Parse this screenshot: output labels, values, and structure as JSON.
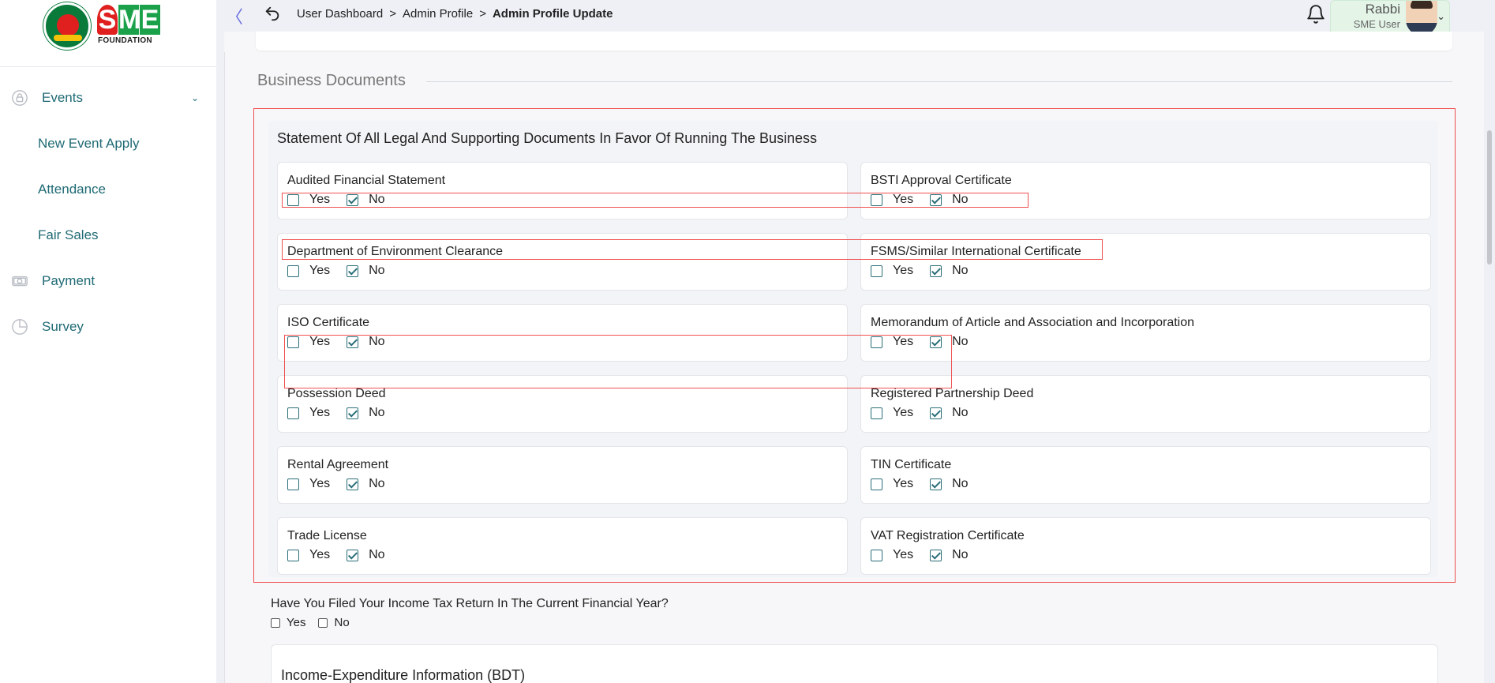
{
  "sidebar": {
    "logo_text": "SME",
    "logo_subtext": "FOUNDATION",
    "items": [
      {
        "label": "Events",
        "icon": "lock-icon",
        "expandable": true
      },
      {
        "label": "New Event Apply"
      },
      {
        "label": "Attendance"
      },
      {
        "label": "Fair Sales"
      },
      {
        "label": "Payment",
        "icon": "money-icon"
      },
      {
        "label": "Survey",
        "icon": "pie-chart-icon"
      }
    ]
  },
  "header": {
    "collapse_glyph": "〈",
    "breadcrumb": [
      "User Dashboard",
      "Admin Profile",
      "Admin Profile Update"
    ],
    "separator": ">",
    "user": {
      "name": "Rabbi",
      "role": "SME User"
    },
    "caret": "⌄"
  },
  "section": {
    "title": "Business Documents",
    "heading": "Statement Of All Legal And Supporting Documents In Favor Of Running The Business",
    "yes_label": "Yes",
    "no_label": "No",
    "documents": [
      {
        "label": "Audited Financial Statement",
        "yes": false,
        "no": true
      },
      {
        "label": "BSTI Approval Certificate",
        "yes": false,
        "no": true
      },
      {
        "label": "Department of Environment Clearance",
        "yes": false,
        "no": true
      },
      {
        "label": "FSMS/Similar International Certificate",
        "yes": false,
        "no": true
      },
      {
        "label": "ISO Certificate",
        "yes": false,
        "no": true
      },
      {
        "label": "Memorandum of Article and Association and Incorporation",
        "yes": false,
        "no": true
      },
      {
        "label": "Possession Deed",
        "yes": false,
        "no": true
      },
      {
        "label": "Registered Partnership Deed",
        "yes": false,
        "no": true
      },
      {
        "label": "Rental Agreement",
        "yes": false,
        "no": true
      },
      {
        "label": "TIN Certificate",
        "yes": false,
        "no": true
      },
      {
        "label": "Trade License",
        "yes": false,
        "no": true
      },
      {
        "label": "VAT Registration Certificate",
        "yes": false,
        "no": true
      }
    ]
  },
  "tax": {
    "question": "Have You Filed Your Income Tax Return In The Current Financial Year?",
    "yes_label": "Yes",
    "no_label": "No"
  },
  "income": {
    "title": "Income-Expenditure Information (BDT)"
  },
  "colors": {
    "accent": "#1f6a74",
    "highlight": "#f05050",
    "user_chip": "#e4f5e8"
  }
}
